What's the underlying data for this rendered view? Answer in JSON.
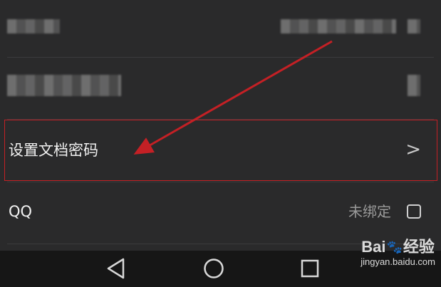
{
  "settings": {
    "rows": [
      {
        "label": "",
        "value": ""
      },
      {
        "label": "",
        "value": ""
      },
      {
        "label": "设置文档密码",
        "chevron": ">"
      },
      {
        "label": "QQ",
        "value": "未绑定"
      }
    ]
  },
  "annotation": {
    "highlight_color": "#c42025"
  },
  "navbar": {
    "icons": [
      "back-triangle-icon",
      "home-circle-icon",
      "recent-square-icon"
    ]
  },
  "watermark": {
    "brand_left": "Bai",
    "brand_right": "经验",
    "url": "jingyan.baidu.com"
  }
}
